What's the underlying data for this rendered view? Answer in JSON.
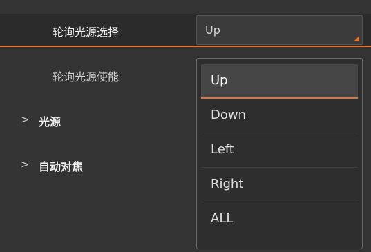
{
  "properties": {
    "polling_source_select": {
      "label": "轮询光源选择",
      "value": "Up"
    },
    "polling_source_enable": {
      "label": "轮询光源使能"
    }
  },
  "groups": [
    {
      "chevron": ">",
      "label": "光源"
    },
    {
      "chevron": ">",
      "label": "自动对焦"
    }
  ],
  "dropdown": {
    "options": [
      "Up",
      "Down",
      "Left",
      "Right",
      "ALL"
    ],
    "selected": "Up"
  },
  "colors": {
    "accent": "#e8732a",
    "background": "#333333"
  }
}
